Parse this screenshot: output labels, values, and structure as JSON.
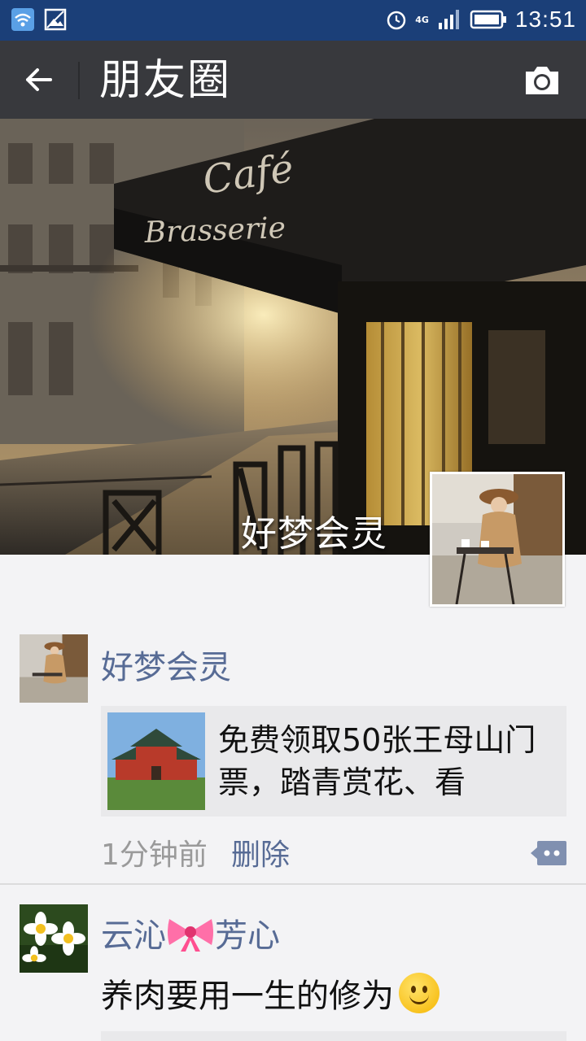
{
  "status_bar": {
    "time": "13:51",
    "network": "4G",
    "icons": [
      "wifi-icon",
      "image-icon",
      "alarm-icon",
      "signal-icon",
      "battery-icon"
    ]
  },
  "header": {
    "title": "朋友圈",
    "back_icon": "arrow-left-icon",
    "camera_icon": "camera-icon"
  },
  "cover": {
    "sign_line1": "Café",
    "sign_line2": "Brasserie",
    "username": "好梦会灵"
  },
  "posts": [
    {
      "author": "好梦会灵",
      "share": {
        "title": "免费领取50张王母山门票，踏青赏花、看"
      },
      "time": "1分钟前",
      "delete_label": "删除"
    },
    {
      "author_part1": "云沁",
      "author_part2": "芳心",
      "text": "养肉要用一生的修为"
    }
  ],
  "colors": {
    "status_bar": "#1b3f78",
    "title_bar": "#38393d",
    "link": "#576b95",
    "background": "#f3f3f5"
  }
}
